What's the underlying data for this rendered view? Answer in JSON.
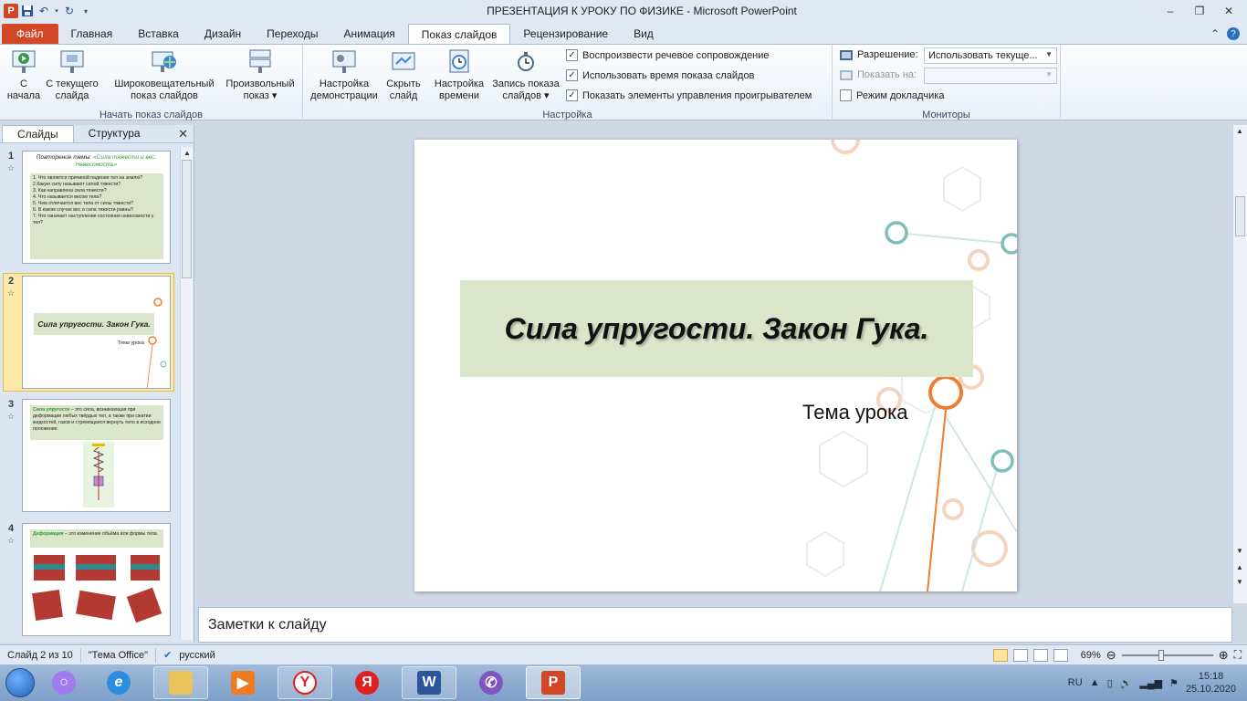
{
  "window": {
    "title": "ПРЕЗЕНТАЦИЯ К УРОКУ ПО ФИЗИКЕ  -  Microsoft PowerPoint"
  },
  "ribbon_tabs": [
    {
      "label": "Файл"
    },
    {
      "label": "Главная"
    },
    {
      "label": "Вставка"
    },
    {
      "label": "Дизайн"
    },
    {
      "label": "Переходы"
    },
    {
      "label": "Анимация"
    },
    {
      "label": "Показ слайдов"
    },
    {
      "label": "Рецензирование"
    },
    {
      "label": "Вид"
    }
  ],
  "ribbon": {
    "start_group": {
      "label": "Начать показ слайдов",
      "from_start_l1": "С",
      "from_start_l2": "начала",
      "from_current_l1": "С текущего",
      "from_current_l2": "слайда",
      "broadcast_l1": "Широковещательный",
      "broadcast_l2": "показ слайдов",
      "custom_l1": "Произвольный",
      "custom_l2": "показ ▾"
    },
    "setup_group": {
      "label": "Настройка",
      "setup_l1": "Настройка",
      "setup_l2": "демонстрации",
      "hide_l1": "Скрыть",
      "hide_l2": "слайд",
      "rehearse_l1": "Настройка",
      "rehearse_l2": "времени",
      "record_l1": "Запись показа",
      "record_l2": "слайдов ▾",
      "chk_narration": "Воспроизвести речевое сопровождение",
      "chk_timings": "Использовать время показа слайдов",
      "chk_controls": "Показать элементы управления проигрывателем"
    },
    "monitors_group": {
      "label": "Мониторы",
      "resolution_label": "Разрешение:",
      "resolution_value": "Использовать текуще...",
      "show_on_label": "Показать на:",
      "show_on_value": "",
      "presenter_view": "Режим докладчика"
    }
  },
  "left_panel": {
    "tab_slides": "Слайды",
    "tab_outline": "Структура",
    "close": "✕",
    "thumbs": [
      {
        "num": "1",
        "title_black": "Повторение темы: ",
        "title_green": "«Сила тяжести и вес. Невесомость»",
        "lines": [
          "1. Что является причиной падения тел на землю?",
          "2.Какую силу называют силой тяжести?",
          "3. Как направлена сила тяжести?",
          "4. Что называется весом тела?",
          "5. Чем отличается вес тела от силы тяжести?",
          "6. В каком случае вес и сила тяжести равны?",
          "7. Что означает наступление состояния невесомости у тел?"
        ]
      },
      {
        "num": "2",
        "title": "Сила упругости. Закон Гука.",
        "subtitle": "Тема урока"
      },
      {
        "num": "3",
        "term": "Сила упругости",
        "text": " – это сила, возникающая при деформации любых твёрдых тел, а также при сжатии жидкостей, газов и стремящаяся вернуть тело в исходное положение."
      },
      {
        "num": "4",
        "term": "Деформация",
        "text": " – это изменение объёма или формы тела."
      }
    ]
  },
  "slide": {
    "title": "Сила упругости. Закон Гука.",
    "subtitle": "Тема урока"
  },
  "notes": {
    "placeholder": "Заметки к слайду"
  },
  "status": {
    "slide_counter": "Слайд 2 из 10",
    "theme": "\"Тема Office\"",
    "language": "русский",
    "zoom": "69%"
  },
  "taskbar": {
    "lang": "RU",
    "time": "15:18",
    "date": "25.10.2020",
    "apps": [
      "internet-explorer",
      "file-explorer",
      "media-player",
      "yandex-browser",
      "yandex",
      "word",
      "viber",
      "powerpoint"
    ]
  },
  "colors": {
    "file_tab": "#d24726",
    "title_box": "#dbe5c9",
    "selected_thumb": "#f6d36a",
    "accent_orange": "#ef7d2f",
    "accent_teal": "#6fb5b0"
  }
}
